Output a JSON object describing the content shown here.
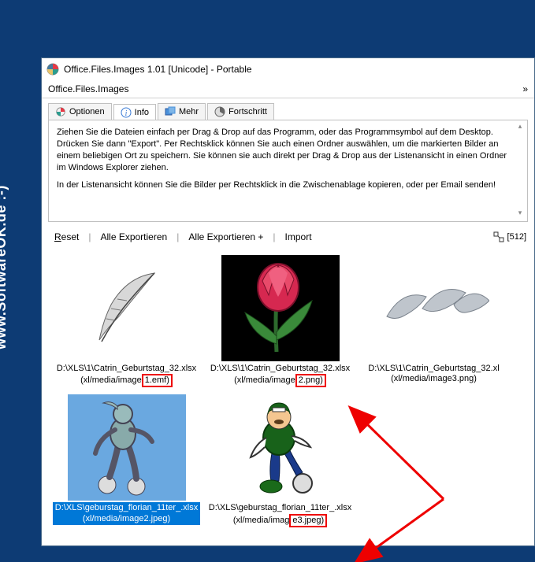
{
  "watermark": "www.SoftwareOK.de :-)",
  "window": {
    "title": "Office.Files.Images 1.01 [Unicode] - Portable"
  },
  "menubar": {
    "item1": "Office.Files.Images",
    "right": "»"
  },
  "tabs": {
    "optionen": "Optionen",
    "info": "Info",
    "mehr": "Mehr",
    "fortschritt": "Fortschritt"
  },
  "info_text": {
    "p1": "Ziehen Sie die Dateien einfach per Drag & Drop auf das Programm, oder das Programmsymbol auf dem Desktop. Drücken Sie dann \"Export\". Per Rechtsklick können Sie auch einen Ordner auswählen, um die markierten Bilder an einem beliebigen Ort zu speichern. Sie können sie auch direkt per Drag & Drop aus der Listenansicht in einen Ordner im Windows Explorer ziehen.",
    "p2": "In der Listenansicht können Sie die Bilder per Rechtsklick in die Zwischenablage kopieren, oder per Email senden!"
  },
  "toolbar": {
    "reset_pre": "R",
    "reset_rest": "eset",
    "export_all": "Alle Exportieren",
    "export_all_plus": "Alle Exportieren +",
    "import": "Import",
    "size": "[512]"
  },
  "thumbs": [
    {
      "line1": "D:\\XLS\\1\\Catrin_Geburtstag_32.xlsx",
      "line2_a": "(xl/media/image",
      "line2_b": "1.emf)"
    },
    {
      "line1": "D:\\XLS\\1\\Catrin_Geburtstag_32.xlsx",
      "line2_a": "(xl/media/image",
      "line2_b": "2.png)"
    },
    {
      "line1": "D:\\XLS\\1\\Catrin_Geburtstag_32.xl",
      "line2_a": "(xl/media/image3.png)",
      "line2_b": ""
    },
    {
      "line1": "D:\\XLS\\geburstag_florian_11ter_.xlsx",
      "line2_a": "(xl/media/image2.jpeg)",
      "line2_b": ""
    },
    {
      "line1": "D:\\XLS\\geburstag_florian_11ter_.xlsx",
      "line2_a": "(xl/media/imag",
      "line2_b": "e3.jpeg)"
    }
  ]
}
